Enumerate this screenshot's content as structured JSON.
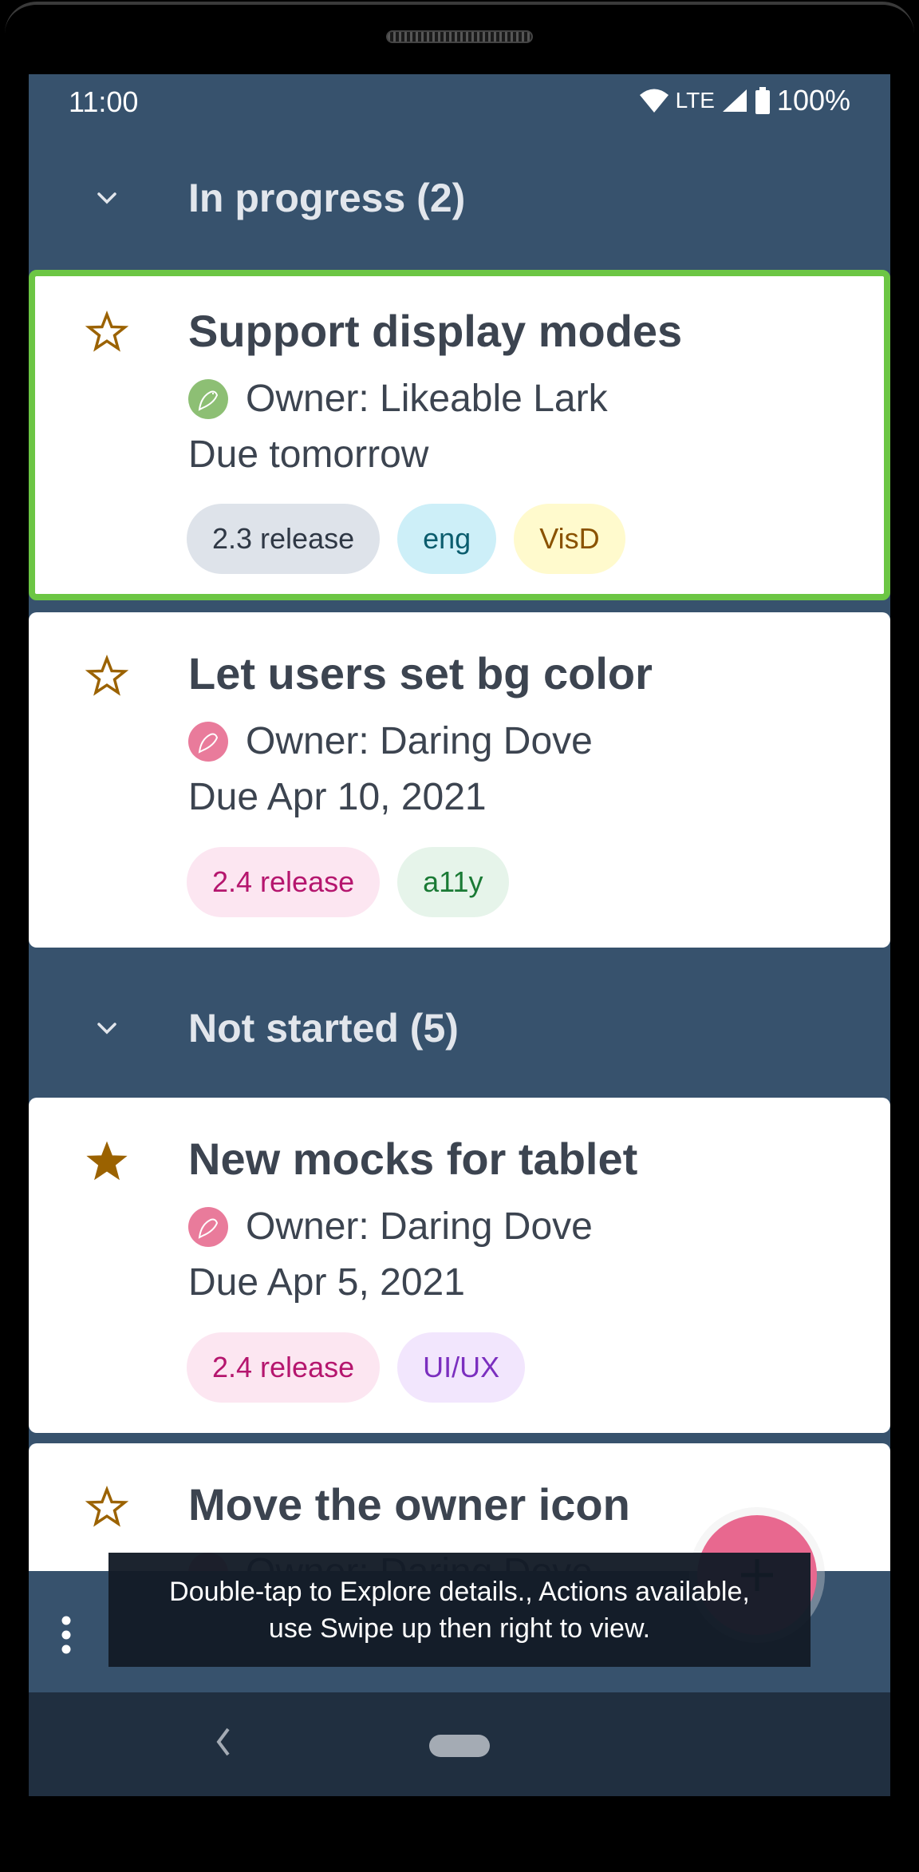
{
  "status_bar": {
    "time": "11:00",
    "network": "LTE",
    "battery": "100%",
    "icons": [
      "wifi-icon",
      "signal-icon",
      "battery-icon"
    ]
  },
  "sections": [
    {
      "title": "In progress (2)",
      "icon": "chevron-down-icon",
      "cards": [
        {
          "title": "Support display modes",
          "starred": false,
          "selected": true,
          "owner": "Owner: Likeable Lark",
          "owner_avatar_color": "#8dbf74",
          "due": "Due tomorrow",
          "tags": [
            {
              "label": "2.3 release",
              "bg": "#dee3ea",
              "fg": "#2f3845"
            },
            {
              "label": "eng",
              "bg": "#cdeff8",
              "fg": "#0b5d6e"
            },
            {
              "label": "VisD",
              "bg": "#fffacd",
              "fg": "#8a5200"
            }
          ]
        },
        {
          "title": "Let users set bg color",
          "starred": false,
          "selected": false,
          "owner": "Owner: Daring Dove",
          "owner_avatar_color": "#e97b9b",
          "due": "Due Apr 10, 2021",
          "tags": [
            {
              "label": "2.4 release",
              "bg": "#fce6f1",
              "fg": "#b5166e"
            },
            {
              "label": "a11y",
              "bg": "#e6f4ea",
              "fg": "#1a7a35"
            }
          ]
        }
      ]
    },
    {
      "title": "Not started (5)",
      "icon": "chevron-down-icon",
      "cards": [
        {
          "title": "New mocks for tablet",
          "starred": true,
          "selected": false,
          "owner": "Owner: Daring Dove",
          "owner_avatar_color": "#e97b9b",
          "due": "Due Apr 5, 2021",
          "tags": [
            {
              "label": "2.4 release",
              "bg": "#fce6f1",
              "fg": "#b5166e"
            },
            {
              "label": "UI/UX",
              "bg": "#f2e6fd",
              "fg": "#7b2fbf"
            }
          ]
        },
        {
          "title": "Move the owner icon",
          "starred": false,
          "selected": false,
          "owner": "Owner: Daring Dove",
          "owner_avatar_color": "#e97b9b"
        }
      ]
    }
  ],
  "toast": {
    "line1": "Double-tap to Explore details., Actions available,",
    "line2": "use Swipe up then right to view."
  },
  "bottom_bar": {
    "menu_icon": "overflow-menu-icon",
    "fab_icon": "plus-icon"
  },
  "nav_bar": {
    "back_icon": "back-icon",
    "home_icon": "home-pill-icon"
  },
  "colors": {
    "background": "#37526d",
    "selected_border": "#6cc644",
    "star": "#9b6200",
    "fab": "#e8688f"
  }
}
